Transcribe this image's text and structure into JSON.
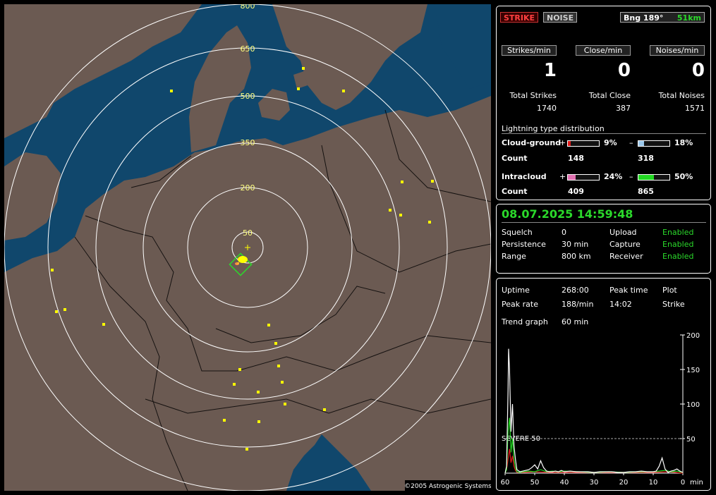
{
  "map": {
    "range_labels": [
      "800",
      "650",
      "500",
      "350",
      "200",
      "50"
    ],
    "copyright": "©2005 Astrogenic Systems",
    "colors": {
      "land": "#6b5a52",
      "sea": "#10476c",
      "rings": "#ffffff",
      "strike": "#ffff00"
    }
  },
  "header": {
    "strike_label": "STRIKE",
    "noise_label": "NOISE",
    "bearing_label": "Bng 189°",
    "distance_label": "51km"
  },
  "rates": {
    "strikes_label": "Strikes/min",
    "close_label": "Close/min",
    "noises_label": "Noises/min",
    "strikes_value": "1",
    "close_value": "0",
    "noises_value": "0"
  },
  "totals": {
    "strikes_label": "Total Strikes",
    "close_label": "Total Close",
    "noises_label": "Total Noises",
    "strikes_value": "1740",
    "close_value": "387",
    "noises_value": "1571"
  },
  "distribution": {
    "title": "Lightning type distribution",
    "cg_label": "Cloud-ground",
    "ic_label": "Intracloud",
    "count_label": "Count",
    "plus": "+",
    "minus": "–",
    "cg_plus_pct": "9%",
    "cg_minus_pct": "18%",
    "ic_plus_pct": "24%",
    "ic_minus_pct": "50%",
    "cg_plus_count": "148",
    "cg_minus_count": "318",
    "ic_plus_count": "409",
    "ic_minus_count": "865",
    "levels": {
      "cg_plus": 9,
      "cg_minus": 18,
      "ic_plus": 24,
      "ic_minus": 50
    },
    "colors": {
      "cg_plus": "#e01818",
      "cg_minus": "#9cc8ea",
      "ic_plus": "#e070b0",
      "ic_minus": "#22d822"
    }
  },
  "status": {
    "datetime": "08.07.2025 14:59:48",
    "squelch_label": "Squelch",
    "squelch_value": "0",
    "persistence_label": "Persistence",
    "persistence_value": "30 min",
    "range_label": "Range",
    "range_value": "800 km",
    "upload_label": "Upload",
    "upload_value": "Enabled",
    "capture_label": "Capture",
    "capture_value": "Enabled",
    "receiver_label": "Receiver",
    "receiver_value": "Enabled"
  },
  "stats": {
    "uptime_label": "Uptime",
    "uptime_value": "268:00",
    "peak_time_label": "Peak time",
    "peak_time_value": "14:02",
    "plot_label": "Plot",
    "plot_value": "Strike",
    "peak_rate_label": "Peak rate",
    "peak_rate_value": "188/min",
    "trend_label": "Trend graph",
    "trend_value": "60 min"
  },
  "chart_data": {
    "type": "line",
    "xlabel": "min",
    "x_ticks": [
      "60",
      "50",
      "40",
      "30",
      "20",
      "10",
      "0"
    ],
    "y_ticks": [
      "200",
      "150",
      "100",
      "50"
    ],
    "xlim": [
      60,
      0
    ],
    "ylim": [
      0,
      200
    ],
    "threshold": {
      "label": "SEVERE 50",
      "value": 50
    },
    "series": [
      {
        "color": "#ffffff",
        "x": [
          60,
          59.5,
          59,
          58.8,
          58.5,
          58,
          57.5,
          57,
          56.5,
          56,
          55,
          54,
          53,
          52,
          51,
          50,
          49,
          48,
          47,
          46,
          45,
          44,
          43,
          42,
          41,
          40,
          38,
          36,
          34,
          32,
          30,
          28,
          26,
          24,
          22,
          20,
          18,
          16,
          14,
          12,
          10,
          9,
          8,
          7,
          6,
          5,
          4,
          3,
          2,
          1,
          0
        ],
        "y": [
          0,
          10,
          120,
          180,
          150,
          60,
          100,
          40,
          20,
          5,
          2,
          3,
          4,
          5,
          8,
          12,
          6,
          18,
          8,
          3,
          2,
          2,
          3,
          2,
          4,
          2,
          3,
          2,
          2,
          2,
          1,
          2,
          2,
          2,
          1,
          1,
          2,
          2,
          3,
          2,
          2,
          3,
          10,
          22,
          6,
          1,
          3,
          4,
          6,
          3,
          1
        ]
      },
      {
        "color": "#22d822",
        "x": [
          60,
          59.5,
          59,
          58.5,
          58,
          57.5,
          57,
          56.5,
          56,
          55,
          54,
          52,
          50,
          48,
          46,
          44,
          42,
          40,
          35,
          30,
          25,
          20,
          15,
          10,
          8,
          6,
          4,
          2,
          0
        ],
        "y": [
          0,
          5,
          60,
          80,
          30,
          50,
          20,
          8,
          2,
          1,
          2,
          3,
          2,
          5,
          2,
          3,
          2,
          3,
          2,
          1,
          2,
          1,
          2,
          2,
          3,
          4,
          2,
          3,
          1
        ]
      },
      {
        "color": "#e01818",
        "x": [
          60,
          59.5,
          59,
          58.5,
          58,
          57.5,
          57,
          56.5,
          56,
          55,
          54,
          50,
          45,
          40,
          30,
          20,
          10,
          5,
          0
        ],
        "y": [
          0,
          5,
          20,
          35,
          15,
          25,
          10,
          4,
          1,
          1,
          1,
          2,
          1,
          1,
          1,
          1,
          1,
          2,
          0
        ]
      }
    ]
  }
}
